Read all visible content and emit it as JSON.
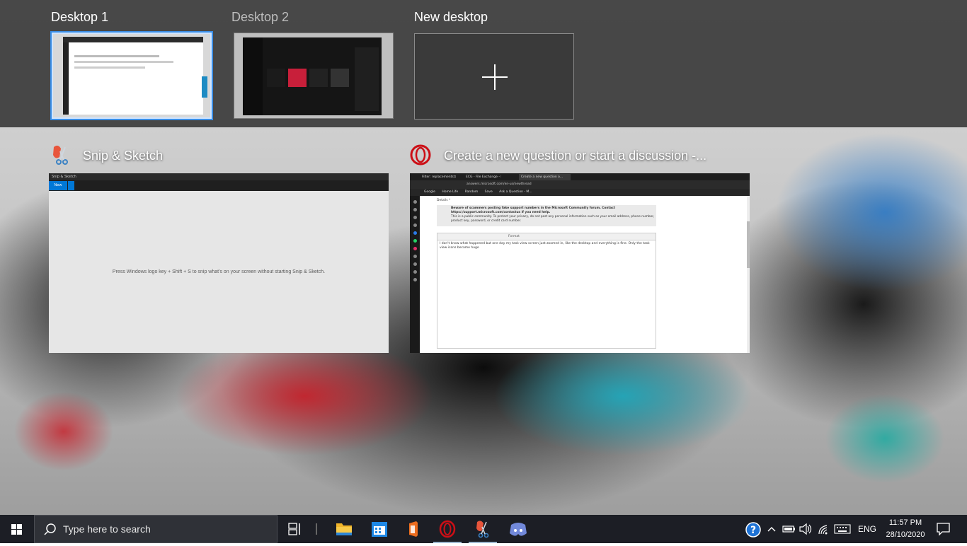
{
  "desktops": [
    {
      "label": "Desktop 1",
      "selected": true
    },
    {
      "label": "Desktop 2",
      "selected": false
    }
  ],
  "new_desktop_label": "New desktop",
  "windows": [
    {
      "title": "Snip & Sketch",
      "app": "Snip & Sketch",
      "titlebar": "Snip & Sketch",
      "new_button": "New",
      "message": "Press Windows logo key + Shift + S to snip what's on your screen without starting Snip & Sketch."
    },
    {
      "title": "Create a new question or start a discussion -...",
      "app": "Opera",
      "tabs": [
        "Filter: replacementstatus to f...",
        "ECG - File Exchange - MAT...",
        "Create a new question o..."
      ],
      "url": "answers.microsoft.com/en-us/newthread",
      "bookmarks": [
        "Google",
        "Home Life",
        "Random",
        "Save",
        "Ask a Question - M..."
      ],
      "details_label": "Details *",
      "warning_title": "Beware of scammers posting fake support numbers in the Microsoft Community forum. Contact https://support.microsoft.com/contactus if you need help.",
      "warning_body": "This is a public community. To protect your privacy, do not post any personal information such as your email address, phone number, product key, password, or credit card number.",
      "toolbar_format": "Format",
      "body_text": "I don't know what happened but one day my task view screen just zoomed in, like the desktop and everything is fine. Only the task view icons became huge"
    }
  ],
  "taskbar": {
    "search_placeholder": "Type here to search",
    "pinned": [
      "task-view",
      "file-explorer",
      "calendar",
      "office",
      "opera",
      "snip-sketch",
      "discord"
    ],
    "language": "ENG",
    "time": "11:57 PM",
    "date": "28/10/2020"
  },
  "colors": {
    "accent": "#0078d7",
    "selection_border": "#3a8ee6",
    "opera_red": "#cc0f16",
    "discord": "#7289da",
    "folder": "#f0b429"
  }
}
